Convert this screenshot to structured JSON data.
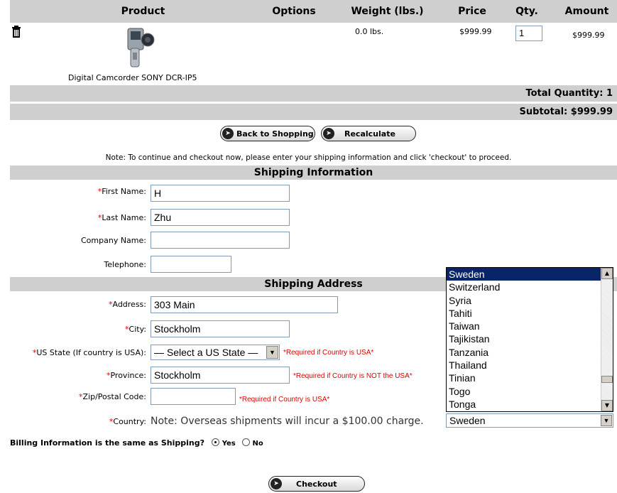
{
  "cart": {
    "headers": {
      "product": "Product",
      "options": "Options",
      "weight": "Weight (lbs.)",
      "price": "Price",
      "qty": "Qty.",
      "amount": "Amount"
    },
    "item": {
      "name": "Digital Camcorder SONY DCR-IP5",
      "options": "",
      "weight": "0.0 lbs.",
      "price": "$999.99",
      "qty": "1",
      "amount": "$999.99"
    },
    "total_quantity": "Total Quantity: 1",
    "subtotal": "Subtotal: $999.99"
  },
  "buttons": {
    "back": "Back to Shopping",
    "recalc": "Recalculate",
    "checkout": "Checkout"
  },
  "note": "Note: To continue and checkout now, please enter your shipping information and click 'checkout' to proceed.",
  "shipping_info": {
    "title": "Shipping Information",
    "first_name_label": "First Name:",
    "first_name": "H",
    "last_name_label": "Last Name:",
    "last_name": "Zhu",
    "company_label": "Company Name:",
    "company": "",
    "telephone_label": "Telephone:",
    "telephone": ""
  },
  "shipping_address": {
    "title": "Shipping Address",
    "address_label": "Address:",
    "address": "303 Main",
    "city_label": "City:",
    "city": "Stockholm",
    "state_label": "US State (If country is USA):",
    "state": "— Select a US State —",
    "state_note": "*Required if Country is USA*",
    "province_label": "Province:",
    "province": "Stockholm",
    "province_note": "*Required if Country is NOT the USA*",
    "zip_label": "Zip/Postal Code:",
    "zip": "",
    "zip_note": "*Required if Country is USA*",
    "country_label": "Country:",
    "country_note": "Note: Overseas shipments will incur a $100.00 charge.",
    "country": "Sweden",
    "country_options": [
      "Sweden",
      "Switzerland",
      "Syria",
      "Tahiti",
      "Taiwan",
      "Tajikistan",
      "Tanzania",
      "Thailand",
      "Tinian",
      "Togo",
      "Tonga"
    ]
  },
  "billing": {
    "question": "Billing Information is the same as Shipping?",
    "yes": "Yes",
    "no": "No",
    "selected": "Yes"
  },
  "required_marker": "*",
  "colors": {
    "header_bg": "#cfcfcf",
    "required": "#e00000",
    "selection": "#0a246a"
  }
}
